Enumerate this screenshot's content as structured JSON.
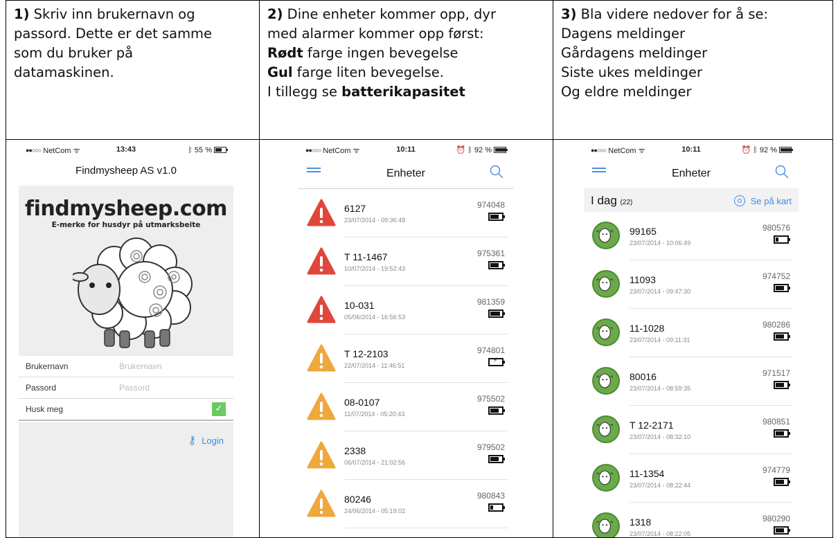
{
  "instructions": [
    {
      "lines": [
        [
          {
            "t": "1)",
            "b": true
          },
          {
            "t": " Skriv inn brukernavn og"
          }
        ],
        [
          {
            "t": "passord. Dette er det samme"
          }
        ],
        [
          {
            "t": "som du bruker på"
          }
        ],
        [
          {
            "t": "datamaskinen."
          }
        ]
      ]
    },
    {
      "lines": [
        [
          {
            "t": "2)",
            "b": true
          },
          {
            "t": " Dine enheter kommer opp, dyr"
          }
        ],
        [
          {
            "t": "med alarmer kommer opp først:"
          }
        ],
        [
          {
            "t": "Rødt",
            "b": true
          },
          {
            "t": " farge ingen bevegelse"
          }
        ],
        [
          {
            "t": "Gul",
            "b": true
          },
          {
            "t": " farge liten bevegelse."
          }
        ],
        [
          {
            "t": "I tillegg se "
          },
          {
            "t": "batterikapasitet",
            "b": true
          }
        ]
      ]
    },
    {
      "lines": [
        [
          {
            "t": "3)",
            "b": true
          },
          {
            "t": " Bla videre nedover for å se:"
          }
        ],
        [
          {
            "t": "Dagens meldinger"
          }
        ],
        [
          {
            "t": "Gårdagens meldinger"
          }
        ],
        [
          {
            "t": "Siste ukes meldinger"
          }
        ],
        [
          {
            "t": "Og eldre meldinger"
          }
        ]
      ]
    }
  ],
  "phone1": {
    "status": {
      "carrier": "NetCom",
      "time": "13:43",
      "battery": "55 %"
    },
    "title": "Findmysheep AS v1.0",
    "logo": {
      "main": "findmysheep.com",
      "sub": "E-merke for husdyr på utmarksbeite"
    },
    "form": {
      "username_label": "Brukernavn",
      "username_placeholder": "Brukernavn",
      "password_label": "Passord",
      "password_placeholder": "Passord",
      "remember_label": "Husk meg"
    },
    "login_label": "Login",
    "colors": {
      "accent": "#3a8ee6",
      "check": "#6bcb5f"
    }
  },
  "phone2": {
    "status": {
      "carrier": "NetCom",
      "time": "10:11",
      "battery": "92 %"
    },
    "title": "Enheter",
    "items": [
      {
        "name": "6127",
        "date": "23/07/2014 - 09:36:48",
        "serial": "974048",
        "alarm": "red",
        "battery": 0.85
      },
      {
        "name": "T 11-1467",
        "date": "10/07/2014 - 19:52:43",
        "serial": "975361",
        "alarm": "red",
        "battery": 0.85
      },
      {
        "name": "10-031",
        "date": "05/06/2014 - 16:56:53",
        "serial": "981359",
        "alarm": "red",
        "battery": 1.0
      },
      {
        "name": "T 12-2103",
        "date": "22/07/2014 - 11:46:51",
        "serial": "974801",
        "alarm": "yellow",
        "battery": 0,
        "charging": true
      },
      {
        "name": "08-0107",
        "date": "11/07/2014 - 05:20:43",
        "serial": "975502",
        "alarm": "yellow",
        "battery": 0.85
      },
      {
        "name": "2338",
        "date": "06/07/2014 - 21:02:56",
        "serial": "979502",
        "alarm": "yellow",
        "battery": 0.85
      },
      {
        "name": "80246",
        "date": "24/06/2014 - 05:19:02",
        "serial": "980843",
        "alarm": "yellow",
        "battery": 0.3
      }
    ],
    "colors": {
      "red": "#e0463a",
      "yellow": "#efa83c"
    }
  },
  "phone3": {
    "status": {
      "carrier": "NetCom",
      "time": "10:11",
      "battery": "92 %"
    },
    "title": "Enheter",
    "day_label": "I dag",
    "day_count": "(22)",
    "map_link": "Se på kart",
    "items": [
      {
        "name": "99165",
        "date": "23/07/2014 - 10:06:49",
        "serial": "980576",
        "battery": 0.3
      },
      {
        "name": "11093",
        "date": "23/07/2014 - 09:47:30",
        "serial": "974752",
        "battery": 0.85
      },
      {
        "name": "11-1028",
        "date": "23/07/2014 - 09:11:31",
        "serial": "980286",
        "battery": 0.85
      },
      {
        "name": "80016",
        "date": "23/07/2014 - 08:59:35",
        "serial": "971517",
        "battery": 0.85
      },
      {
        "name": "T 12-2171",
        "date": "23/07/2014 - 08:32:10",
        "serial": "980851",
        "battery": 0.85
      },
      {
        "name": "11-1354",
        "date": "23/07/2014 - 08:22:44",
        "serial": "974779",
        "battery": 0.85
      },
      {
        "name": "1318",
        "date": "23/07/2014 - 08:22:05",
        "serial": "980290",
        "battery": 0.85
      }
    ]
  }
}
